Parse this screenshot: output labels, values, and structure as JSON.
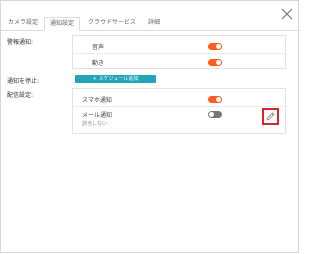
{
  "tabs": [
    {
      "label": "カメラ設定",
      "active": false
    },
    {
      "label": "通知設定",
      "active": true
    },
    {
      "label": "クラウドサービス",
      "active": false
    },
    {
      "label": "詳細",
      "active": false
    }
  ],
  "alarm": {
    "label": "警報通知:",
    "items": [
      {
        "label": "音声",
        "on": true
      },
      {
        "label": "動き",
        "on": true
      }
    ]
  },
  "mute": {
    "label": "通知を停止:",
    "button_label": "+ スケジュール追加"
  },
  "delivery": {
    "label": "配信設定:",
    "items": [
      {
        "label": "スマホ通知",
        "on": true
      },
      {
        "label": "メール通知",
        "sub": "該当しない",
        "on": false
      }
    ]
  },
  "colors": {
    "accent": "#ff5a1f",
    "teal": "#1fa6b7",
    "toggle_off": "#777777",
    "highlight": "#d9232f"
  },
  "icons": {
    "close": "close-icon",
    "edit": "pencil-icon"
  }
}
